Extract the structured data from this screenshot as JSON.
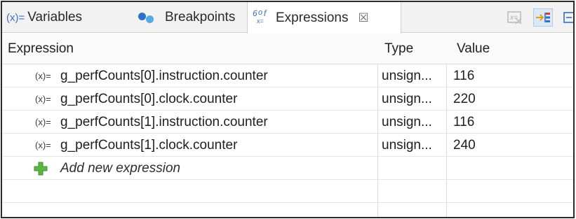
{
  "tabs": {
    "variables": {
      "icon_text": "(x)=",
      "label": "Variables"
    },
    "breakpoints": {
      "label": "Breakpoints"
    },
    "expressions": {
      "label": "Expressions",
      "close": "☒"
    }
  },
  "icons": {
    "variables": "variable-icon",
    "breakpoints": "breakpoints-icon",
    "expressions": "expressions-icon",
    "remove": "remove-expression-icon",
    "collapse": "collapse-all-icon",
    "row": "variable-icon",
    "add": "add-plus-icon"
  },
  "colors": {
    "accent_blue": "#2f6fc6",
    "add_green": "#5bb543",
    "selected_button": "#dde8f5"
  },
  "table": {
    "columns": {
      "expression": "Expression",
      "type": "Type",
      "value": "Value"
    },
    "row_icon_text": "(x)=",
    "rows": [
      {
        "expression": "g_perfCounts[0].instruction.counter",
        "type": "unsign...",
        "value": "116"
      },
      {
        "expression": "g_perfCounts[0].clock.counter",
        "type": "unsign...",
        "value": "220"
      },
      {
        "expression": "g_perfCounts[1].instruction.counter",
        "type": "unsign...",
        "value": "116"
      },
      {
        "expression": "g_perfCounts[1].clock.counter",
        "type": "unsign...",
        "value": "240"
      }
    ],
    "add_label": "Add new expression"
  }
}
